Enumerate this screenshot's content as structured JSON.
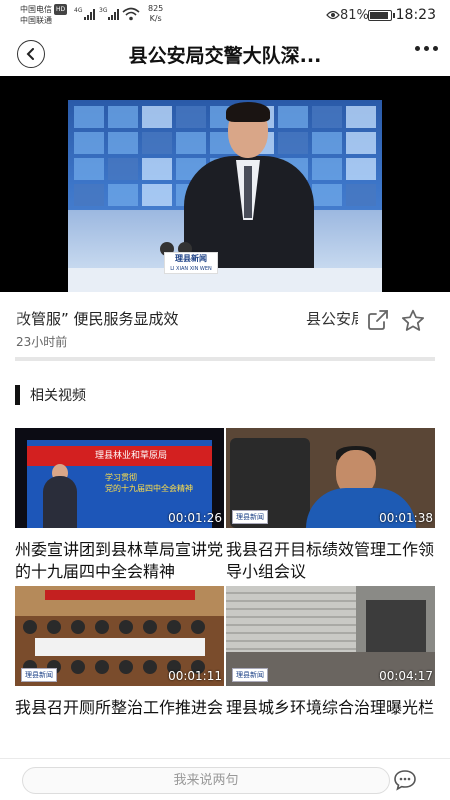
{
  "status_bar": {
    "carrier_1": "中国电信",
    "hd": "HD",
    "carrier_2": "中国联通",
    "net_1": "4G",
    "net_2": "3G",
    "speed_value": "825",
    "speed_unit": "K/s",
    "battery_percent": "81%",
    "battery_level": 0.81,
    "time": "18:23"
  },
  "navbar": {
    "title": "县公安局交警大队深...",
    "back_icon": "chevron-left-icon",
    "more_icon": "more-dots-icon"
  },
  "video": {
    "logo_text": "理县新闻",
    "logo_sub": "LI XIAN XIN WEN"
  },
  "article": {
    "headline": "改管服” 便民服务显成效",
    "source": "县公安局",
    "time_ago": "23小时前",
    "share_icon": "share-icon",
    "star_icon": "star-icon"
  },
  "related": {
    "section_title": "相关视频",
    "videos": [
      {
        "title": "州委宣讲团到县林草局宣讲党的十九届四中全会精神",
        "duration": "00:01:26",
        "thumb_text_1": "理县林业和草原局",
        "thumb_text_2": "学习贯彻",
        "thumb_text_3": "党的十九届四中全会精神"
      },
      {
        "title": "我县召开目标绩效管理工作领导小组会议",
        "duration": "00:01:38",
        "thumb_text_1": "理县新闻"
      },
      {
        "title": "我县召开厕所整治工作推进会",
        "duration": "00:01:11",
        "thumb_text_1": "理县新闻"
      },
      {
        "title": "理县城乡环境综合治理曝光栏",
        "duration": "00:04:17",
        "thumb_text_1": "理县新闻"
      }
    ]
  },
  "bottom_bar": {
    "comment_placeholder": "我来说两句",
    "comment_icon": "comment-icon"
  }
}
